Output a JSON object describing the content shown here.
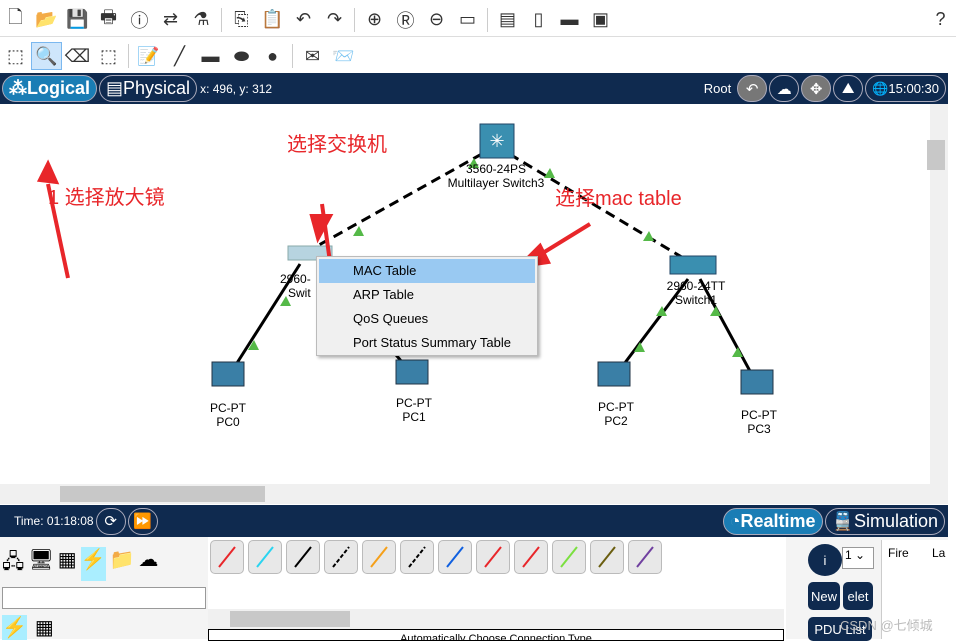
{
  "toolbar1": [
    "new-icon",
    "open-icon",
    "save-icon",
    "print-icon",
    "info-icon",
    "network-wizard-icon",
    "activity-wizard-icon",
    "copy-icon",
    "paste-icon",
    "undo-icon",
    "redo-icon",
    "zoom-in-icon",
    "zoom-reset-icon",
    "zoom-out-icon",
    "window-icon",
    "palette-icon",
    "custom-device-icon",
    "device-template-icon",
    "cluster-icon"
  ],
  "help": "?",
  "toolbar2": [
    "select-icon",
    "inspect-icon",
    "delete-icon",
    "resize-icon",
    "note-icon",
    "line-icon",
    "rectangle-icon",
    "ellipse-icon",
    "freeform-icon",
    "simple-pdu-icon",
    "complex-pdu-icon"
  ],
  "nav": {
    "logical": "Logical",
    "physical": "Physical",
    "coords": "x: 496, y: 312",
    "root": "Root",
    "clock": "15:00:30"
  },
  "devices": {
    "s3_model": "3560-24PS",
    "s3_name": "Multilayer Switch3",
    "s0_model": "2960-",
    "s0_name": "Swit",
    "s1_model": "2960-24TT",
    "s1_name": "Switch1",
    "pc0_model": "PC-PT",
    "pc0_name": "PC0",
    "pc1_model": "PC-PT",
    "pc1_name": "PC1",
    "pc2_model": "PC-PT",
    "pc2_name": "PC2",
    "pc3_model": "PC-PT",
    "pc3_name": "PC3"
  },
  "context_menu": [
    "MAC Table",
    "ARP Table",
    "QoS Queues",
    "Port Status Summary Table"
  ],
  "annotations": {
    "a1": "1 选择放大镜",
    "a2": "选择交换机",
    "a3": "选择mac table"
  },
  "bottom": {
    "time": "Time: 01:18:08",
    "realtime": "Realtime",
    "simulation": "Simulation",
    "status": "Automatically Choose Connection Type"
  },
  "cables": [
    {
      "name": "auto",
      "color": "#e8262a"
    },
    {
      "name": "console",
      "color": "#2ad4f0"
    },
    {
      "name": "straight",
      "color": "#000000"
    },
    {
      "name": "cross",
      "color": "#000000"
    },
    {
      "name": "fiber",
      "color": "#f5a01a"
    },
    {
      "name": "phone",
      "color": "#000000"
    },
    {
      "name": "coaxial",
      "color": "#1060e0"
    },
    {
      "name": "serial-dce",
      "color": "#e8262a"
    },
    {
      "name": "serial-dte",
      "color": "#e8262a"
    },
    {
      "name": "octal",
      "color": "#7be040"
    },
    {
      "name": "iot",
      "color": "#6b5e10"
    },
    {
      "name": "usb",
      "color": "#7040a0"
    }
  ],
  "pdu": {
    "select": "1",
    "new": "New",
    "delete": "elet",
    "list": "PDU List",
    "col_fire": "Fire",
    "col_last": "La"
  },
  "watermark": "CSDN @七倾城"
}
